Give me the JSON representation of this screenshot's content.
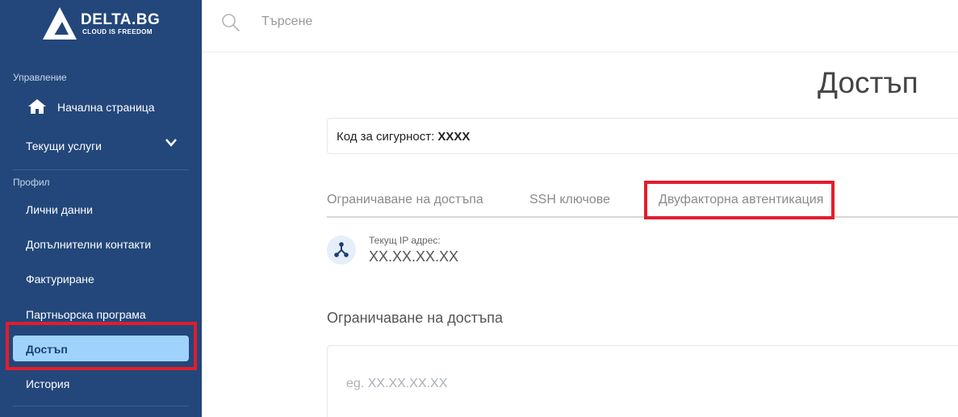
{
  "brand": {
    "name": "DELTA.BG",
    "tagline": "CLOUD IS FREEDOM"
  },
  "search": {
    "placeholder": "Търсене"
  },
  "sidebar": {
    "sections": [
      {
        "label": "Управление",
        "items": [
          {
            "label": "Начална страница",
            "icon": "home-icon"
          },
          {
            "label": "Текущи услуги",
            "icon": "chevron-down-icon"
          }
        ]
      },
      {
        "label": "Профил",
        "items": [
          {
            "label": "Лични данни"
          },
          {
            "label": "Допълнителни контакти"
          },
          {
            "label": "Фактуриране"
          },
          {
            "label": "Партньорска програма"
          },
          {
            "label": "Достъп",
            "active": true
          },
          {
            "label": "История"
          }
        ]
      }
    ]
  },
  "main": {
    "title": "Достъп",
    "security": {
      "label": "Код за сигурност:",
      "code": "XXXX"
    },
    "tabs": [
      {
        "label": "Ограничаване на достъпа"
      },
      {
        "label": "SSH ключове"
      },
      {
        "label": "Двуфакторна автентикация",
        "highlighted": true
      }
    ],
    "ip": {
      "label": "Текущ IP адрес:",
      "value": "XX.XX.XX.XX",
      "icon": "network-icon"
    },
    "restrict": {
      "title": "Ограничаване на достъпа",
      "placeholder": "eg. XX.XX.XX.XX"
    }
  },
  "colors": {
    "sidebar_bg": "#23477a",
    "active_bg": "#9fd3fb",
    "highlight_red": "#e31d2b"
  }
}
